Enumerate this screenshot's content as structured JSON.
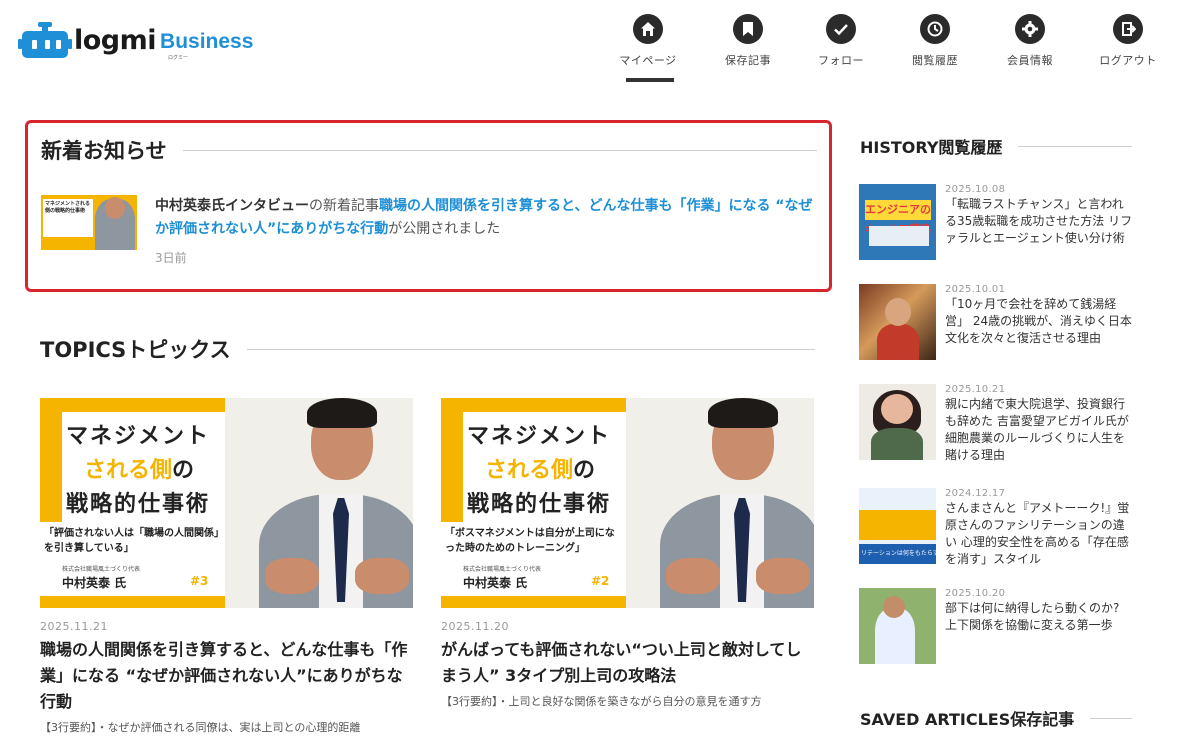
{
  "header": {
    "logo": {
      "word": "logmi",
      "business": "Business",
      "sub": "ログミー"
    },
    "nav": [
      {
        "label": "マイページ",
        "icon": "home-icon",
        "active": true
      },
      {
        "label": "保存記事",
        "icon": "bookmark-icon",
        "active": false
      },
      {
        "label": "フォロー",
        "icon": "check-icon",
        "active": false
      },
      {
        "label": "閲覧履歴",
        "icon": "history-icon",
        "active": false
      },
      {
        "label": "会員情報",
        "icon": "gear-icon",
        "active": false
      },
      {
        "label": "ログアウト",
        "icon": "logout-icon",
        "active": false
      }
    ]
  },
  "notice": {
    "title": "新着お知らせ",
    "author": "中村英泰氏インタビュー",
    "mid": "の新着記事",
    "link": "職場の人間関係を引き算すると、どんな仕事も「作業」になる “なぜか評価されない人”にありがちな行動",
    "tail": "が公開されました",
    "ago": "3日前",
    "thumb_text": "マネジメントされる側の戦略的仕事術"
  },
  "topics": {
    "title": "TOPICSトピックス",
    "cards": [
      {
        "thumb": {
          "line1": "マネジメント",
          "line2": "される側",
          "line2b": "の",
          "line3": "戦略的仕事術",
          "quote": "「評価されない人は「職場の人間関係」を引き算している」",
          "org": "株式会社職場風土づくり代表",
          "name": "中村英泰 氏",
          "no": "#3"
        },
        "date": "2025.11.21",
        "title": "職場の人間関係を引き算すると、どんな仕事も「作業」になる “なぜか評価されない人”にありがちな行動",
        "summary": "【3行要約】・なぜか評価される同僚は、実は上司との心理的距離"
      },
      {
        "thumb": {
          "line1": "マネジメント",
          "line2": "される側",
          "line2b": "の",
          "line3": "戦略的仕事術",
          "quote": "「ボスマネジメントは自分が上司になった時のためのトレーニング」",
          "org": "株式会社職場風土づくり代表",
          "name": "中村英泰 氏",
          "no": "#2"
        },
        "date": "2025.11.20",
        "title": "がんばっても評価されない“つい上司と敵対してしまう人” 3タイプ別上司の攻略法",
        "summary": "【3行要約】・上司と良好な関係を築きながら自分の意見を通す方"
      }
    ]
  },
  "sidebar": {
    "history_title": "HISTORY閲覧履歴",
    "history": [
      {
        "date": "2025.10.08",
        "title": "「転職ラストチャンス」と言われる35歳転職を成功させた方法 リファラルとエージェント使い分け術",
        "thumb_text": "エンジニアのキャリア戦略"
      },
      {
        "date": "2025.10.01",
        "title": "「10ヶ月で会社を辞めて銭湯経営」 24歳の挑戦が、消えゆく日本文化を次々と復活させる理由"
      },
      {
        "date": "2025.10.21",
        "title": "親に内緒で東大院退学、投資銀行も辞めた 吉富愛望アビガイル氏が細胞農業のルールづくりに人生を賭ける理由"
      },
      {
        "date": "2024.12.17",
        "title": "さんまさんと『アメトーーク!』蛍原さんのファシリテーションの違い 心理的安全性を高める「存在感を消す」スタイル",
        "thumb_text": "リテーションは何をもたらす"
      },
      {
        "date": "2025.10.20",
        "title": "部下は何に納得したら動くのか? 上下関係を協働に変える第一歩"
      }
    ],
    "saved_title": "SAVED ARTICLES保存記事"
  },
  "colors": {
    "accent_blue": "#1c8fd6",
    "brand_yellow": "#f4b400",
    "notice_border": "#d8262e"
  }
}
